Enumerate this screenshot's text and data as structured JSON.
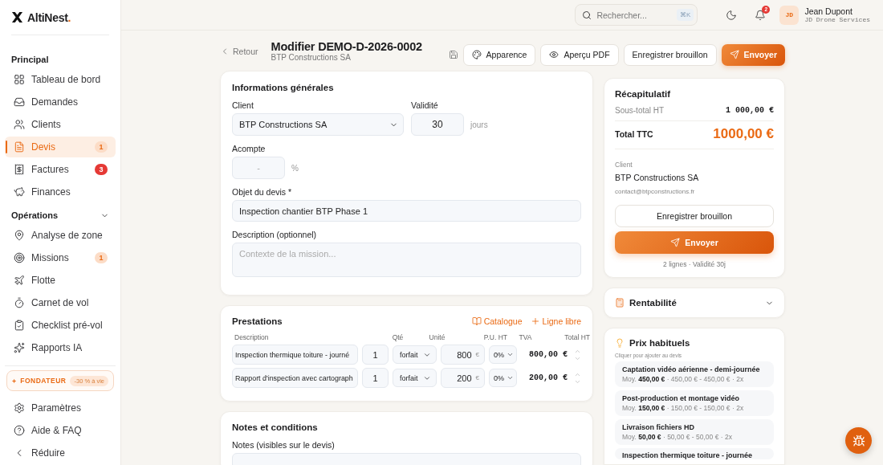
{
  "sidebar": {
    "logo": {
      "name": "AltiNest",
      "dot": "."
    },
    "sections": [
      {
        "title": "Principal",
        "items": [
          {
            "label": "Tableau de bord",
            "selected": false
          },
          {
            "label": "Demandes",
            "selected": false
          },
          {
            "label": "Clients",
            "selected": false
          },
          {
            "label": "Devis",
            "selected": true,
            "badge": {
              "text": "1",
              "kind": "soft"
            }
          },
          {
            "label": "Factures",
            "selected": false,
            "badge": {
              "text": "3",
              "kind": "alert"
            }
          },
          {
            "label": "Finances",
            "selected": false
          }
        ]
      },
      {
        "title": "Opérations",
        "expanded": true,
        "items": [
          {
            "label": "Analyse de zone",
            "selected": false
          },
          {
            "label": "Missions",
            "selected": false,
            "badge": {
              "text": "1",
              "kind": "soft"
            }
          },
          {
            "label": "Flotte",
            "selected": false
          },
          {
            "label": "Carnet de vol",
            "selected": false
          },
          {
            "label": "Checklist pré-vol",
            "selected": false
          },
          {
            "label": "Rapports IA",
            "selected": false
          }
        ]
      }
    ],
    "founder": {
      "label": "FONDATEUR",
      "offer": "-30 % à vie"
    },
    "footer": [
      {
        "label": "Paramètres"
      },
      {
        "label": "Aide & FAQ"
      },
      {
        "label": "Réduire"
      }
    ]
  },
  "topbar": {
    "search": {
      "placeholder": "Rechercher...",
      "shortcut": "⌘K"
    },
    "notifications": "2",
    "user": {
      "initials": "JD",
      "name": "Jean Dupont",
      "company": "JD Drone Services"
    }
  },
  "page": {
    "back": "Retour",
    "title": "Modifier DEMO-D-2026-0002",
    "subtitle": "BTP Constructions SA",
    "actions": [
      {
        "label": "Apparence",
        "kind": "outline"
      },
      {
        "label": "Aperçu PDF",
        "kind": "outline"
      },
      {
        "label": "Enregistrer brouillon",
        "kind": "outline"
      },
      {
        "label": "Envoyer",
        "kind": "primary"
      }
    ]
  },
  "general": {
    "title": "Informations générales",
    "client": {
      "label": "Client",
      "value": "BTP Constructions SA"
    },
    "validity": {
      "label": "Validité",
      "value": "30",
      "unit": "jours"
    },
    "deposit": {
      "label": "Acompte",
      "placeholder": "-",
      "unit": "%"
    },
    "subject": {
      "label": "Objet du devis *",
      "value": "Inspection chantier BTP Phase 1"
    },
    "description": {
      "label": "Description (optionnel)",
      "placeholder": "Contexte de la mission..."
    }
  },
  "services": {
    "title": "Prestations",
    "links": [
      "Catalogue",
      "Ligne libre"
    ],
    "columns": [
      "Description",
      "Qté",
      "Unité",
      "P.U. HT",
      "TVA",
      "Total HT"
    ],
    "currency": "€",
    "rows": [
      {
        "description": "Inspection thermique toiture - journé",
        "qty": "1",
        "unit": "forfait",
        "price": "800",
        "vat": "0%",
        "total": "800,00 €"
      },
      {
        "description": "Rapport d'inspection avec cartograph",
        "qty": "1",
        "unit": "forfait",
        "price": "200",
        "vat": "0%",
        "total": "200,00 €"
      }
    ]
  },
  "notes": {
    "title": "Notes et conditions",
    "label": "Notes (visibles sur le devis)"
  },
  "summary": {
    "title": "Récapitulatif",
    "subtotal_label": "Sous-total HT",
    "subtotal": "1 000,00 €",
    "total_label": "Total TTC",
    "total": "1000,00 €",
    "client_label": "Client",
    "client_name": "BTP Constructions SA",
    "client_email": "contact@btpconstructions.fr",
    "draft": "Enregistrer brouillon",
    "send": "Envoyer",
    "footnote": "2 lignes · Validité 30j"
  },
  "profitability": {
    "title": "Rentabilité",
    "expanded": false
  },
  "usual_prices": {
    "title": "Prix habituels",
    "hint": "Cliquer pour ajouter au devis",
    "separator": "·",
    "items": [
      {
        "name": "Captation vidéo aérienne - demi-journée",
        "avg_label": "Moy.",
        "avg": "450,00 €",
        "range": "450,00 € - 450,00 €",
        "count": "2x"
      },
      {
        "name": "Post-production et montage vidéo",
        "avg_label": "Moy.",
        "avg": "150,00 €",
        "range": "150,00 € - 150,00 €",
        "count": "2x"
      },
      {
        "name": "Livraison fichiers HD",
        "avg_label": "Moy.",
        "avg": "50,00 €",
        "range": "50,00 € - 50,00 €",
        "count": "2x"
      },
      {
        "name": "Inspection thermique toiture - journée"
      }
    ]
  }
}
